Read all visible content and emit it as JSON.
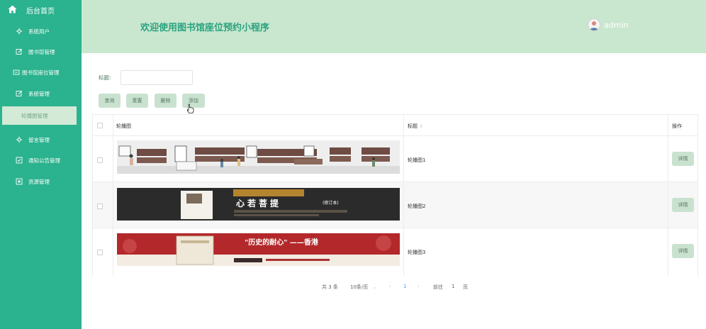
{
  "sidebar": {
    "home": {
      "label": "后台首页",
      "icon": "home-icon"
    },
    "items": [
      {
        "label": "系统用户",
        "icon": "gear-flower-icon"
      },
      {
        "label": "图书馆管理",
        "icon": "edit-icon"
      },
      {
        "label": "图书馆座位管理",
        "icon": "seat-icon"
      },
      {
        "label": "系统管理",
        "icon": "edit-icon"
      },
      {
        "label": "轮播图管理",
        "icon": "",
        "active": true
      },
      {
        "label": "留言管理",
        "icon": "gear-flower-icon"
      },
      {
        "label": "通知公告管理",
        "icon": "checkbox-icon"
      },
      {
        "label": "资源管理",
        "icon": "window-icon"
      }
    ]
  },
  "header": {
    "title": "欢迎使用图书馆座位预约小程序",
    "username": "admin"
  },
  "search": {
    "label": "标题:",
    "value": "",
    "placeholder": ""
  },
  "actions": {
    "query": "查询",
    "reset": "重置",
    "delete": "删除",
    "add": "添加"
  },
  "table": {
    "columns": {
      "image": "轮播图",
      "title": "标题",
      "ops": "操作"
    },
    "detail_label": "详情",
    "rows": [
      {
        "title": "轮播图1",
        "banner": {
          "text": "",
          "sub": ""
        }
      },
      {
        "title": "轮播图2",
        "banner": {
          "text": "心若菩提",
          "sub": "(修订本)"
        }
      },
      {
        "title": "轮播图3",
        "banner": {
          "text": "\"历史的耐心\" ——香港",
          "sub": ""
        }
      }
    ]
  },
  "pagination": {
    "total": "共 3 条",
    "page_size": "10条/页",
    "current": "1",
    "goto_label": "前往",
    "goto_value": "1",
    "page_unit": "页"
  },
  "colors": {
    "sidebar": "#2bb28e",
    "header": "#c9e7cf",
    "accent": "#2aa37f",
    "button": "#c9e2cf"
  }
}
